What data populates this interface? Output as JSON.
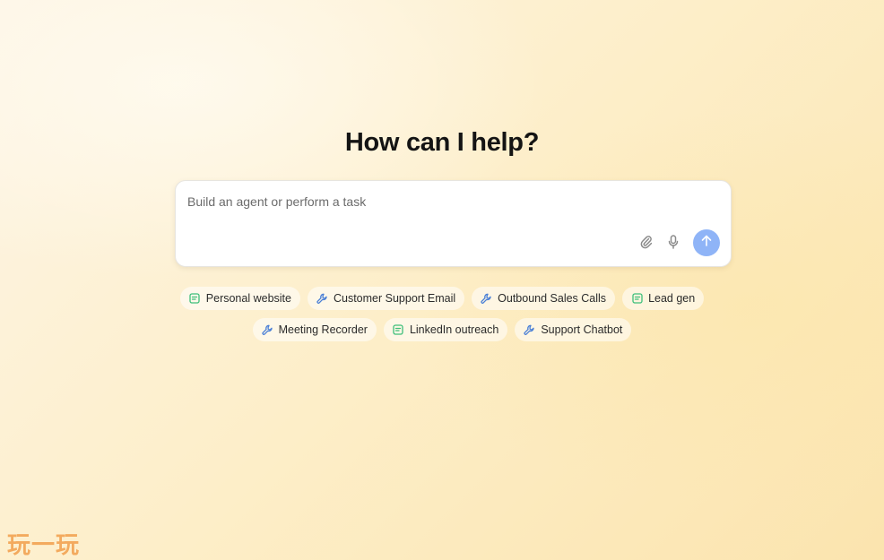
{
  "headline": "How can I help?",
  "prompt": {
    "placeholder": "Build an agent or perform a task"
  },
  "icons": {
    "attach": "paperclip-icon",
    "mic": "microphone-icon",
    "send": "arrow-up-icon",
    "website": "page-icon",
    "tool": "wrench-icon"
  },
  "colors": {
    "send_button": "#8fb4f7",
    "page_icon": "#3dbf7a",
    "wrench_icon": "#4a7fd6"
  },
  "chips": {
    "personal_website": "Personal website",
    "customer_support_email": "Customer Support Email",
    "outbound_sales_calls": "Outbound Sales Calls",
    "lead_gen": "Lead gen",
    "meeting_recorder": "Meeting Recorder",
    "linkedin_outreach": "LinkedIn outreach",
    "support_chatbot": "Support Chatbot"
  },
  "watermark": "玩一玩"
}
